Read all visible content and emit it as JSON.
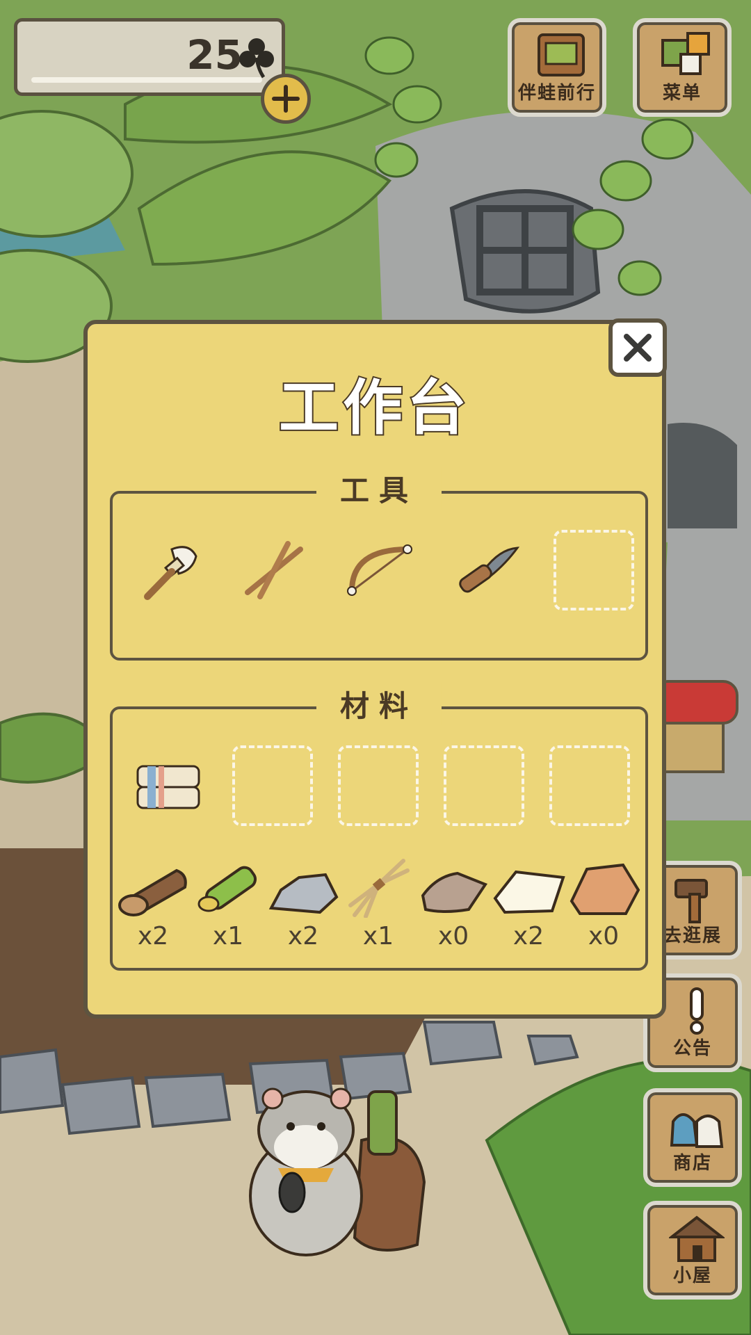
{
  "currency": {
    "clover_count": "25",
    "icon": "clover-icon",
    "add_icon": "plus-icon"
  },
  "top_menu": {
    "travel_label": "伴蛙前行",
    "menu_label": "菜单"
  },
  "side_menu": {
    "explore_label": "去逛展",
    "notice_label": "公告",
    "shop_label": "商店",
    "house_label": "小屋"
  },
  "dialog": {
    "title": "工作台",
    "tools_title": "工具",
    "materials_title": "材料",
    "tools": [
      "brush",
      "crossed-sticks",
      "bow-saw",
      "knife"
    ],
    "material_counts": [
      {
        "name": "log",
        "count": "x2"
      },
      {
        "name": "bamboo",
        "count": "x1"
      },
      {
        "name": "stone",
        "count": "x2"
      },
      {
        "name": "straw",
        "count": "x1"
      },
      {
        "name": "leather",
        "count": "x0"
      },
      {
        "name": "paper",
        "count": "x2"
      },
      {
        "name": "clay",
        "count": "x0"
      }
    ]
  },
  "colors": {
    "panel": "#ecd679",
    "border": "#5d5440",
    "slot_dash": "#fbf6e6"
  }
}
